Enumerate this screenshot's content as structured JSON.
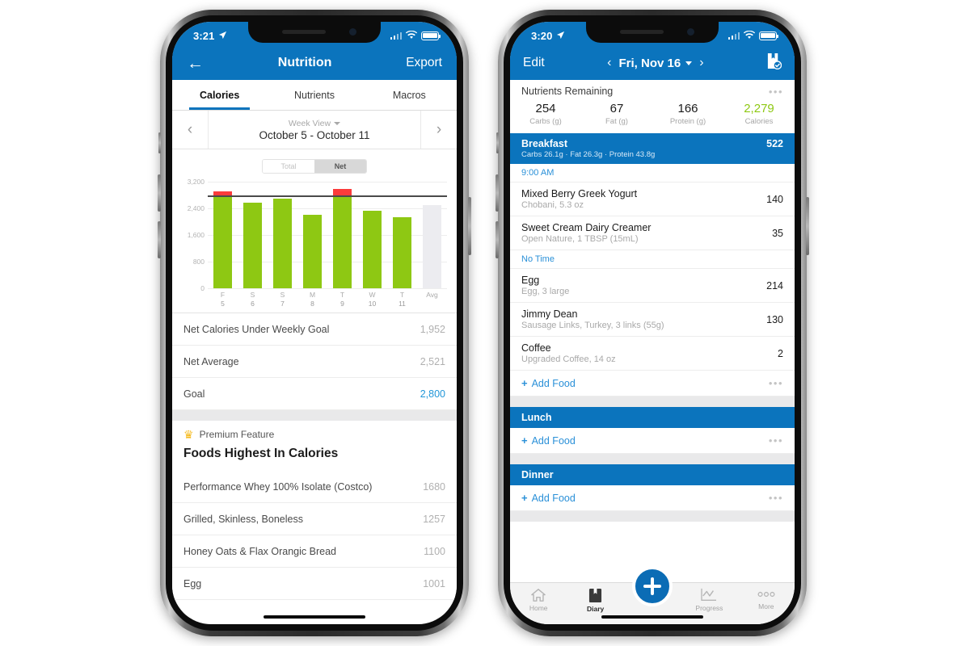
{
  "left_phone": {
    "status": {
      "time": "3:21",
      "location_icon": "location-arrow-icon",
      "signal_icon": "cellular-bars-icon",
      "wifi_icon": "wifi-icon",
      "battery_icon": "battery-icon"
    },
    "nav": {
      "back_icon": "back-arrow-icon",
      "title": "Nutrition",
      "action": "Export"
    },
    "tabs": [
      {
        "label": "Calories",
        "active": true
      },
      {
        "label": "Nutrients",
        "active": false
      },
      {
        "label": "Macros",
        "active": false
      }
    ],
    "week_bar": {
      "prev_icon": "chevron-left-icon",
      "next_icon": "chevron-right-icon",
      "view_mode": "Week View",
      "range": "October 5 - October 11"
    },
    "segmented": {
      "options": [
        "Total",
        "Net"
      ],
      "selected": "Net"
    },
    "summary_rows": [
      {
        "label": "Net Calories Under Weekly Goal",
        "value": "1,952",
        "accent": false
      },
      {
        "label": "Net Average",
        "value": "2,521",
        "accent": false
      },
      {
        "label": "Goal",
        "value": "2,800",
        "accent": true
      }
    ],
    "premium": {
      "crown_icon": "crown-icon",
      "label": "Premium Feature",
      "section_title": "Foods Highest In Calories"
    },
    "foods": [
      {
        "name": "Performance Whey 100% Isolate (Costco)",
        "calories": "1680"
      },
      {
        "name": "Grilled, Skinless, Boneless",
        "calories": "1257"
      },
      {
        "name": "Honey Oats & Flax Orangic Bread",
        "calories": "1100"
      },
      {
        "name": "Egg",
        "calories": "1001"
      }
    ]
  },
  "right_phone": {
    "status": {
      "time": "3:20",
      "location_icon": "location-arrow-icon",
      "signal_icon": "cellular-bars-icon",
      "wifi_icon": "wifi-icon",
      "battery_icon": "battery-icon"
    },
    "nav": {
      "edit": "Edit",
      "prev_icon": "chevron-left-icon",
      "date": "Fri, Nov 16",
      "caret_icon": "chevron-down-icon",
      "next_icon": "chevron-right-icon",
      "save_icon": "save-diary-icon"
    },
    "nutrients_remaining": {
      "title": "Nutrients Remaining",
      "menu_icon": "overflow-menu-icon",
      "cells": [
        {
          "value": "254",
          "label": "Carbs (g)",
          "accent": false
        },
        {
          "value": "67",
          "label": "Fat (g)",
          "accent": false
        },
        {
          "value": "166",
          "label": "Protein (g)",
          "accent": false
        },
        {
          "value": "2,279",
          "label": "Calories",
          "accent": true
        }
      ]
    },
    "meals": [
      {
        "name": "Breakfast",
        "macros": "Carbs 26.1g · Fat 26.3g · Protein 43.8g",
        "calories": "522",
        "groups": [
          {
            "time": "9:00 AM",
            "items": [
              {
                "name": "Mixed Berry Greek Yogurt",
                "desc": "Chobani, 5.3 oz",
                "calories": "140"
              },
              {
                "name": "Sweet Cream Dairy Creamer",
                "desc": "Open Nature, 1 TBSP (15mL)",
                "calories": "35"
              }
            ]
          },
          {
            "time": "No Time",
            "items": [
              {
                "name": "Egg",
                "desc": "Egg, 3 large",
                "calories": "214"
              },
              {
                "name": "Jimmy Dean",
                "desc": "Sausage Links, Turkey, 3 links (55g)",
                "calories": "130"
              },
              {
                "name": "Coffee",
                "desc": "Upgraded Coffee, 14 oz",
                "calories": "2"
              }
            ]
          }
        ],
        "add_label": "Add Food"
      },
      {
        "name": "Lunch",
        "macros": "",
        "calories": "",
        "groups": [],
        "add_label": "Add Food"
      },
      {
        "name": "Dinner",
        "macros": "",
        "calories": "",
        "groups": [],
        "add_label": "Add Food"
      }
    ],
    "tabbar": [
      {
        "label": "Home",
        "icon": "home-icon",
        "active": false
      },
      {
        "label": "Diary",
        "icon": "diary-book-icon",
        "active": true
      },
      {
        "label": "",
        "icon": "add-plus-fab-icon",
        "active": false
      },
      {
        "label": "Progress",
        "icon": "progress-chart-icon",
        "active": false
      },
      {
        "label": "More",
        "icon": "more-dots-icon",
        "active": false
      }
    ]
  },
  "colors": {
    "brand_blue": "#0b74bd",
    "bar_green": "#8ec813",
    "over_red": "#fb3b3b",
    "link_blue": "#2a90d8",
    "goal_line": "#4a4a4a"
  },
  "chart_data": {
    "type": "bar",
    "title": "",
    "xlabel": "",
    "ylabel": "",
    "ylim": [
      0,
      3200
    ],
    "yticks": [
      0,
      800,
      1600,
      2400,
      3200
    ],
    "ytick_labels": [
      "0",
      "800",
      "1,600",
      "2,400",
      "3,200"
    ],
    "grid": true,
    "legend": false,
    "goal_line": 2800,
    "categories": [
      "F",
      "S",
      "S",
      "M",
      "T",
      "W",
      "T",
      "Avg"
    ],
    "category_sub": [
      "5",
      "6",
      "7",
      "8",
      "9",
      "10",
      "11",
      ""
    ],
    "values": [
      2920,
      2560,
      2700,
      2200,
      2980,
      2330,
      2140,
      2500
    ],
    "over_goal_portion": [
      120,
      0,
      0,
      0,
      180,
      0,
      0,
      0
    ],
    "series": [
      {
        "name": "Net Calories",
        "values": [
          2920,
          2560,
          2700,
          2200,
          2980,
          2330,
          2140,
          2500
        ]
      }
    ],
    "bar_colors": [
      "#8ec813",
      "#8ec813",
      "#8ec813",
      "#8ec813",
      "#8ec813",
      "#8ec813",
      "#8ec813",
      "#ececf0"
    ]
  }
}
